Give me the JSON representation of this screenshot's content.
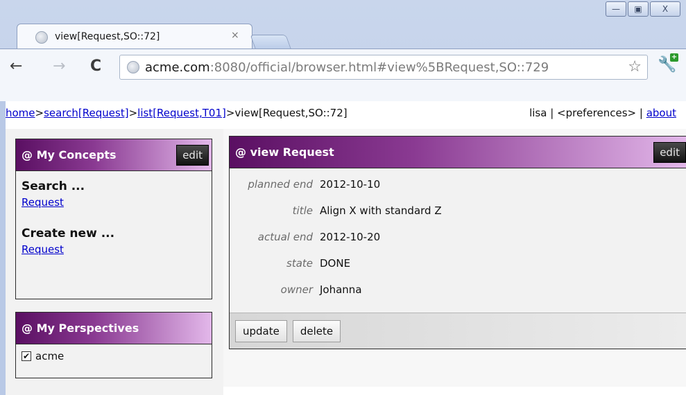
{
  "browser": {
    "tab_title": "view[Request,SO::72]",
    "tab_close": "×",
    "url_host": "acme.com",
    "url_path": ":8080/official/browser.html#view%5BRequest,SO::729",
    "controls": {
      "minimize": "—",
      "maximize": "▣",
      "close": "X"
    },
    "back": "←",
    "forward": "→",
    "reload": "C",
    "star": "☆",
    "wrench": "🔧",
    "wrench_badge": "+"
  },
  "breadcrumb": {
    "home": "home",
    "sep1": ">",
    "search": "search[Request]",
    "sep2": ">",
    "list": "list[Request,T01]",
    "sep3": ">",
    "current": "view[Request,SO::72]"
  },
  "userbar": {
    "user": "lisa",
    "sep1": " | ",
    "preferences": "<preferences>",
    "sep2": " | ",
    "about": "about"
  },
  "my_concepts": {
    "title": "@ My Concepts",
    "edit_label": "edit",
    "search_title": "Search ...",
    "search_link": "Request",
    "create_title": "Create new ...",
    "create_link": "Request"
  },
  "my_perspectives": {
    "title": "@ My Perspectives",
    "items": [
      {
        "label": "acme",
        "checked": true
      }
    ],
    "check_mark": "✔"
  },
  "view_request": {
    "title": "@ view Request",
    "edit_label": "edit",
    "fields": [
      {
        "label": "planned end",
        "value": "2012-10-10"
      },
      {
        "label": "title",
        "value": "Align X with standard Z"
      },
      {
        "label": "actual end",
        "value": "2012-10-20"
      },
      {
        "label": "state",
        "value": "DONE"
      },
      {
        "label": "owner",
        "value": "Johanna"
      }
    ],
    "update_label": "update",
    "delete_label": "delete"
  },
  "colors": {
    "header_gradient_start": "#5a0f62",
    "header_gradient_end": "#e3b8ea",
    "link": "#0000cc"
  }
}
